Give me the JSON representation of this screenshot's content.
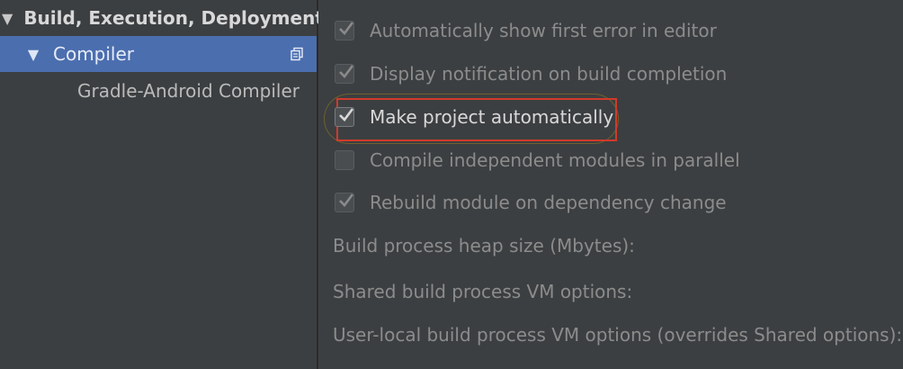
{
  "sidebar": {
    "items": [
      {
        "label": "Build, Execution, Deployment",
        "expanded": true
      },
      {
        "label": "Compiler",
        "expanded": true,
        "selected": true
      },
      {
        "label": "Gradle-Android Compiler"
      }
    ]
  },
  "compiler": {
    "options": [
      {
        "label": "Automatically show first error in editor",
        "checked": true,
        "enabled": false
      },
      {
        "label": "Display notification on build completion",
        "checked": true,
        "enabled": false
      },
      {
        "label": "Make project automatically",
        "checked": true,
        "enabled": true,
        "highlighted": true
      },
      {
        "label": "Compile independent modules in parallel",
        "checked": false,
        "enabled": false
      },
      {
        "label": "Rebuild module on dependency change",
        "checked": true,
        "enabled": false
      }
    ],
    "fields": [
      {
        "label": "Build process heap size (Mbytes):"
      },
      {
        "label": "Shared build process VM options:"
      },
      {
        "label": "User-local build process VM options (overrides Shared options):"
      }
    ]
  },
  "colors": {
    "background": "#3c3f41",
    "selection": "#4b6eaf",
    "highlight_box": "#d13a2a"
  },
  "icons": {
    "tree_expand": "triangle-down-icon",
    "copy": "copy-icon",
    "check": "checkmark-icon"
  }
}
